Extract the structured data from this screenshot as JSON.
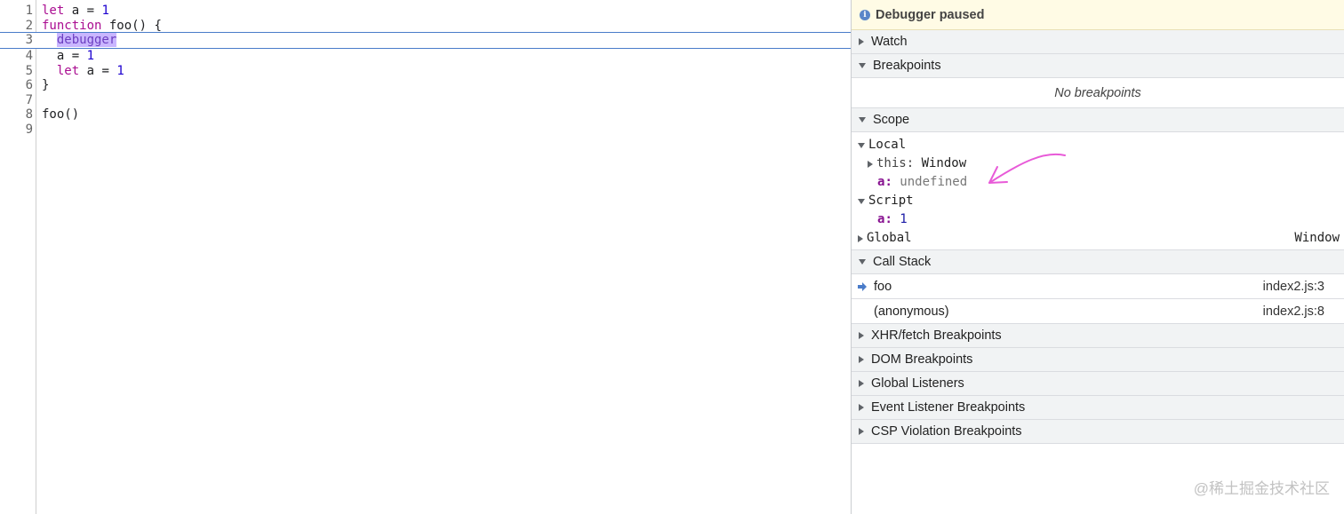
{
  "editor": {
    "lines": [
      {
        "num": "1",
        "parts": [
          {
            "t": "let",
            "c": "kw"
          },
          {
            "t": " a = ",
            "c": ""
          },
          {
            "t": "1",
            "c": "num"
          }
        ]
      },
      {
        "num": "2",
        "parts": [
          {
            "t": "function",
            "c": "kw"
          },
          {
            "t": " foo() {",
            "c": ""
          }
        ]
      },
      {
        "num": "3",
        "parts": [
          {
            "t": "  ",
            "c": ""
          },
          {
            "t": "debugger",
            "c": "hl"
          }
        ],
        "paused": true
      },
      {
        "num": "4",
        "parts": [
          {
            "t": "  a = ",
            "c": ""
          },
          {
            "t": "1",
            "c": "num"
          }
        ]
      },
      {
        "num": "5",
        "parts": [
          {
            "t": "  ",
            "c": ""
          },
          {
            "t": "let",
            "c": "kw"
          },
          {
            "t": " a = ",
            "c": ""
          },
          {
            "t": "1",
            "c": "num"
          }
        ]
      },
      {
        "num": "6",
        "parts": [
          {
            "t": "}",
            "c": ""
          }
        ]
      },
      {
        "num": "7",
        "parts": []
      },
      {
        "num": "8",
        "parts": [
          {
            "t": "foo()",
            "c": ""
          }
        ]
      },
      {
        "num": "9",
        "parts": []
      }
    ]
  },
  "sidebar": {
    "paused_label": "Debugger paused",
    "info_glyph": "i",
    "watch_label": "Watch",
    "breakpoints_label": "Breakpoints",
    "no_breakpoints": "No breakpoints",
    "scope_label": "Scope",
    "scope": {
      "local_label": "Local",
      "this_key": "this",
      "this_value": "Window",
      "a_key": "a",
      "a_value": "undefined",
      "script_label": "Script",
      "script_a_key": "a",
      "script_a_value": "1",
      "global_label": "Global",
      "global_value": "Window"
    },
    "call_stack_label": "Call Stack",
    "call_stack": [
      {
        "name": "foo",
        "location": "index2.js:3",
        "current": true
      },
      {
        "name": "(anonymous)",
        "location": "index2.js:8",
        "current": false
      }
    ],
    "xhr_label": "XHR/fetch Breakpoints",
    "dom_label": "DOM Breakpoints",
    "global_listeners_label": "Global Listeners",
    "event_listener_label": "Event Listener Breakpoints",
    "csp_label": "CSP Violation Breakpoints"
  },
  "colors": {
    "annotation": "#e85ad8",
    "paused_line": "#4a7cc9",
    "arrow_icon": "#4a7cc9"
  },
  "watermark": "@稀土掘金技术社区"
}
